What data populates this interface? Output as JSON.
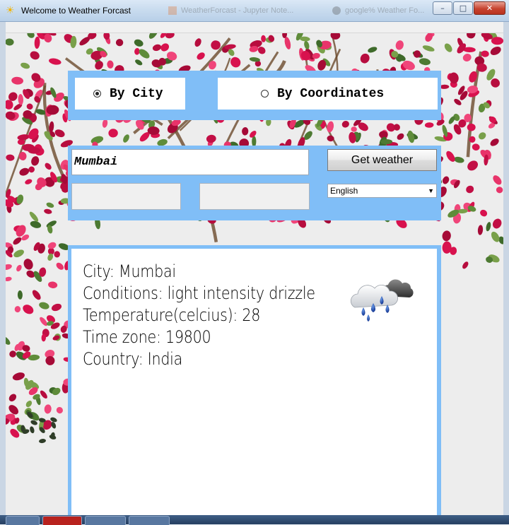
{
  "window": {
    "title": "Welcome to Weather Forcast",
    "app_icon": "sun-icon",
    "controls": [
      "minimize-icon",
      "maximize-icon",
      "close-icon"
    ],
    "background_tabs": [
      "WeatherForcast - Jupyter Note...",
      "google% Weather Fo..."
    ]
  },
  "search_mode": {
    "by_city_label": "By City",
    "by_coordinates_label": "By Coordinates",
    "selected": "By City"
  },
  "search": {
    "city_value": "Mumbai",
    "latitude_value": "",
    "longitude_value": "",
    "get_weather_label": "Get weather",
    "language_selected": "English"
  },
  "result": {
    "line_city": "City: Mumbai",
    "line_conditions": "Conditions: light intensity drizzle",
    "line_temperature": "Temperature(celcius): 28",
    "line_timezone": "Time zone: 19800",
    "line_country": "Country: India",
    "icon": "rain-cloud-icon"
  },
  "colors": {
    "panel_blue": "#80bef7",
    "flower_pink": "#d8124e",
    "leaf_green": "#4d7a32"
  }
}
